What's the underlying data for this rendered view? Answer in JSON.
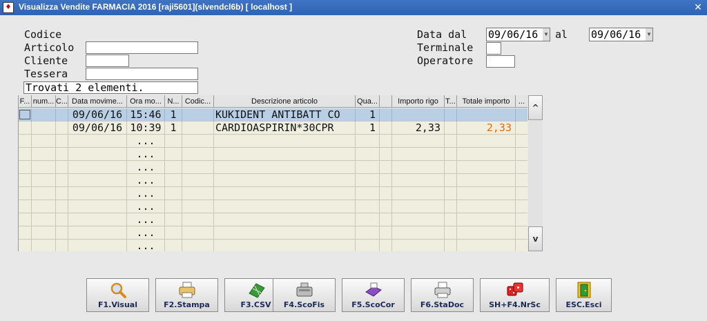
{
  "window": {
    "title": "Visualizza Vendite FARMACIA 2016 [raji5601](slvendcl6b) [ localhost ]",
    "close_glyph": "✕"
  },
  "form": {
    "codice_label": "Codice",
    "articolo_label": "Articolo",
    "articolo_value": "",
    "cliente_label": "Cliente",
    "cliente_value": "",
    "tessera_label": "Tessera",
    "tessera_value": "",
    "status_text": "Trovati 2 elementi.",
    "data_dal_label": "Data dal",
    "data_dal_value": "09/06/16",
    "al_label": "al",
    "data_al_value": "09/06/16",
    "terminale_label": "Terminale",
    "terminale_value": "",
    "operatore_label": "Operatore",
    "operatore_value": ""
  },
  "table": {
    "headers": [
      "F...",
      "num...",
      "C...",
      "Data movime...",
      "Ora mo...",
      "N...",
      "Codic...",
      "Descrizione articolo",
      "Qua...",
      "",
      "Importo rigo",
      "T...",
      "Totale importo",
      "..."
    ],
    "rows": [
      {
        "data": "09/06/16",
        "ora": "15:46",
        "n": "1",
        "descrizione": "KUKIDENT ANTIBATT CO",
        "qta": "1",
        "importo": "",
        "totale": ""
      },
      {
        "data": "09/06/16",
        "ora": "10:39",
        "n": "1",
        "descrizione": "CARDIOASPIRIN*30CPR",
        "qta": "1",
        "importo": "2,33",
        "totale": "2,33"
      }
    ],
    "empty_marker": "...",
    "scroll_up": "^",
    "scroll_down": "v"
  },
  "toolbar": [
    {
      "label": "F1.Visual",
      "icon": "magnifier-icon"
    },
    {
      "label": "F2.Stampa",
      "icon": "printer-icon"
    },
    {
      "label": "F3.CSV",
      "icon": "spreadsheet-icon"
    },
    {
      "label": "F4.ScoFis",
      "icon": "cash-register-icon"
    },
    {
      "label": "F5.ScoCor",
      "icon": "fiscal-printer-icon"
    },
    {
      "label": "F6.StaDoc",
      "icon": "document-printer-icon"
    },
    {
      "label": "SH+F4.NrSc",
      "icon": "dice-icon"
    },
    {
      "label": "ESC.Esci",
      "icon": "exit-door-icon"
    }
  ]
}
